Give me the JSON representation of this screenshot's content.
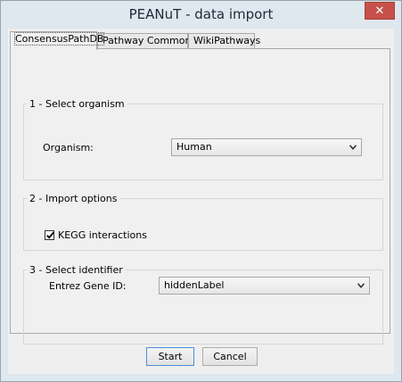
{
  "window": {
    "title": "PEANuT - data import",
    "close_glyph": "✕"
  },
  "tabs": [
    {
      "label": "ConsensusPathDB",
      "active": true
    },
    {
      "label": "Pathway Commons",
      "active": false
    },
    {
      "label": "WikiPathways",
      "active": false
    }
  ],
  "section_organism": {
    "legend": "1 - Select organism",
    "label": "Organism:",
    "value": "Human"
  },
  "section_import": {
    "legend": "2 - Import options",
    "checkbox_label": "KEGG interactions",
    "checked": true
  },
  "section_identifier": {
    "legend": "3 - Select identifier",
    "label": "Entrez Gene ID:",
    "value": "hiddenLabel"
  },
  "buttons": {
    "start": "Start",
    "cancel": "Cancel"
  },
  "colors": {
    "frame": "#dfe7ef",
    "close": "#c7504a",
    "panel": "#f0f0f0"
  }
}
